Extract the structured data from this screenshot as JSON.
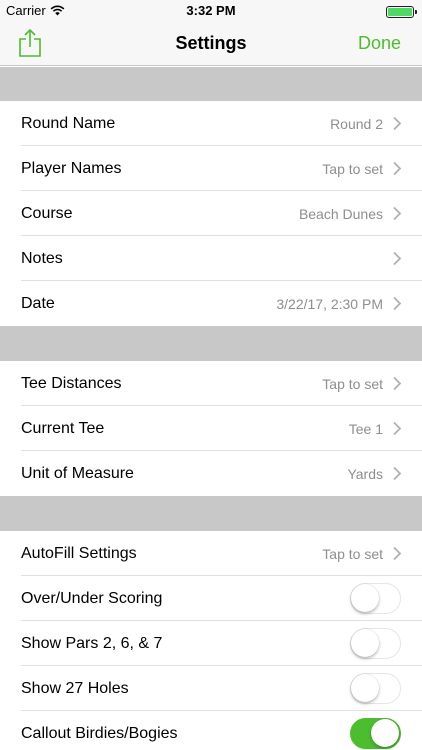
{
  "status_bar": {
    "carrier": "Carrier",
    "time": "3:32 PM"
  },
  "nav": {
    "title": "Settings",
    "done_label": "Done"
  },
  "colors": {
    "accent": "#4cbd2f",
    "section_gap": "#c8c8c8",
    "value_text": "#8e8e93"
  },
  "section1": [
    {
      "label": "Round Name",
      "value": "Round 2"
    },
    {
      "label": "Player Names",
      "value": "Tap to set"
    },
    {
      "label": "Course",
      "value": "Beach Dunes"
    },
    {
      "label": "Notes",
      "value": ""
    },
    {
      "label": "Date",
      "value": "3/22/17, 2:30 PM"
    }
  ],
  "section2": [
    {
      "label": "Tee Distances",
      "value": "Tap to set"
    },
    {
      "label": "Current Tee",
      "value": "Tee 1"
    },
    {
      "label": "Unit of Measure",
      "value": "Yards"
    }
  ],
  "section3": {
    "autofill": {
      "label": "AutoFill Settings",
      "value": "Tap to set"
    },
    "toggles": [
      {
        "label": "Over/Under Scoring",
        "on": false
      },
      {
        "label": "Show Pars 2, 6, & 7",
        "on": false
      },
      {
        "label": "Show 27 Holes",
        "on": false
      },
      {
        "label": "Callout Birdies/Bogies",
        "on": true
      }
    ]
  }
}
